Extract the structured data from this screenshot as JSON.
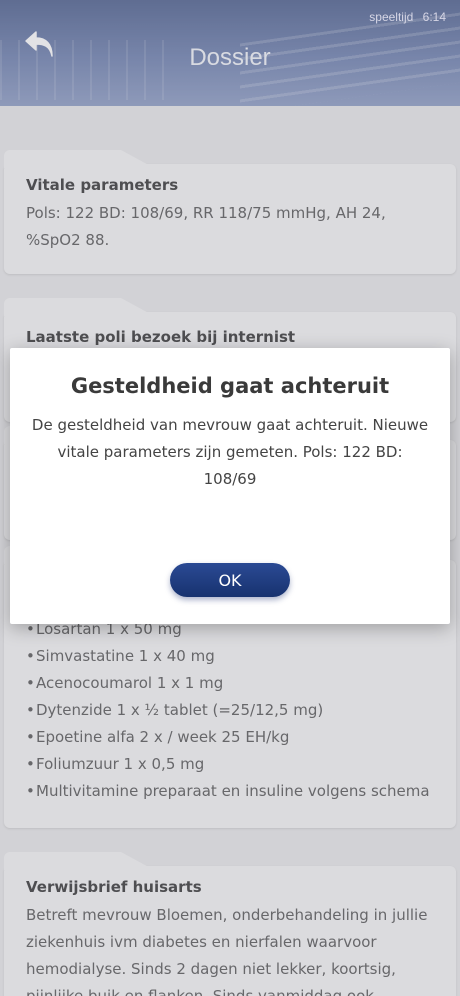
{
  "status": {
    "label": "speeltijd",
    "time": "6:14"
  },
  "header": {
    "title": "Dossier"
  },
  "cards": {
    "vitals": {
      "title": "Vitale parameters",
      "text": "Pols: 122 BD: 108/69, RR 118/75 mmHg, AH 24, %SpO2 88."
    },
    "poli": {
      "title": "Laatste poli bezoek bij internist"
    },
    "medication": {
      "items": [
        "Losartan 1 x 50 mg",
        "Simvastatine 1 x 40 mg",
        "Acenocoumarol 1 x 1 mg",
        "Dytenzide 1 x ½ tablet (=25/12,5 mg)",
        "Epoetine alfa 2 x / week  25 EH/kg",
        "Foliumzuur 1 x 0,5 mg",
        "Multivitamine preparaat en insuline volgens schema"
      ]
    },
    "referral": {
      "title": "Verwijsbrief huisarts",
      "text": "Betreft mevrouw Bloemen, onderbehandeling in jullie ziekenhuis ivm diabetes en nierfalen waarvoor hemodialyse. Sinds 2 dagen niet lekker, koortsig, pijnlijke buik en flanken. Sinds vanmiddag ook verward"
    }
  },
  "modal": {
    "title": "Gesteldheid gaat achteruit",
    "message": "De gesteldheid van mevrouw gaat achteruit. Nieuwe vitale parameters zijn gemeten. Pols: 122 BD: 108/69",
    "ok_label": "OK"
  },
  "icons": {
    "back": "back-arrow-icon"
  },
  "colors": {
    "header": "#5a6d9c",
    "button": "#1f3a80"
  }
}
